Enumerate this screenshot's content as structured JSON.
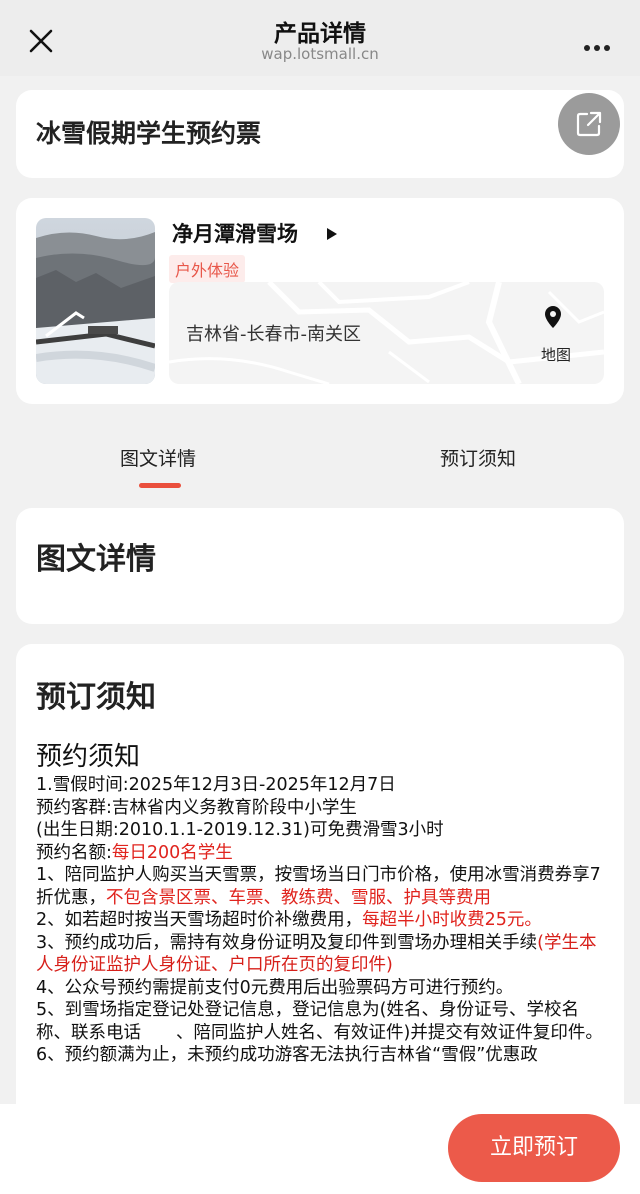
{
  "header": {
    "title": "产品详情",
    "url": "wap.lotsmall.cn"
  },
  "product": {
    "title": "冰雪假期学生预约票"
  },
  "venue": {
    "name": "净月潭滑雪场",
    "tag": "户外体验",
    "address": "吉林省-长春市-南关区",
    "map_label": "地图"
  },
  "tabs": [
    {
      "label": "图文详情",
      "active": true
    },
    {
      "label": "预订须知",
      "active": false
    }
  ],
  "detail_section": {
    "heading": "图文详情"
  },
  "notice_section": {
    "heading": "预订须知",
    "subheading": "预约须知",
    "lines": {
      "l1": "1.雪假时间:2025年12月3日-2025年12月7日",
      "l2": "预约客群:吉林省内义务教育阶段中小学生",
      "l3": "(出生日期:2010.1.1-2019.12.31)可免费滑雪3小时",
      "l4a": "预约名额:",
      "l4b": "每日200名学生",
      "l5a": "1、陪同监护人购买当天雪票，按雪场当日门市价格，使用冰雪消费券享7折优惠，",
      "l5b": "不包含景区票、车票、教练费、雪服、护具等费用",
      "l6a": "2、如若超时按当天雪场超时价补缴费用，",
      "l6b": "每超半小时收费25元。",
      "l7a": "3、预约成功后，需持有效身份证明及复印件到雪场办理相关手续",
      "l7b": "(学生本人身份证监护人身份证、户口所在页的复印件)",
      "l8": "4、公众号预约需提前支付0元费用后出验票码方可进行预约。",
      "l9": "5、到雪场指定登记处登记信息，登记信息为(姓名、身份证号、学校名称、联系电话　　、陪同监护人姓名、有效证件)并提交有效证件复印件。",
      "l10": "6、预约额满为止，未预约成功游客无法执行吉林省“雪假”优惠政"
    }
  },
  "actions": {
    "book_now": "立即预订"
  },
  "colors": {
    "accent": "#ea4f3c",
    "button": "#ec5a4a",
    "highlight_text": "#e0241e"
  },
  "icons": [
    "close-icon",
    "more-icon",
    "share-icon",
    "play-arrow-icon",
    "location-pin-icon"
  ]
}
